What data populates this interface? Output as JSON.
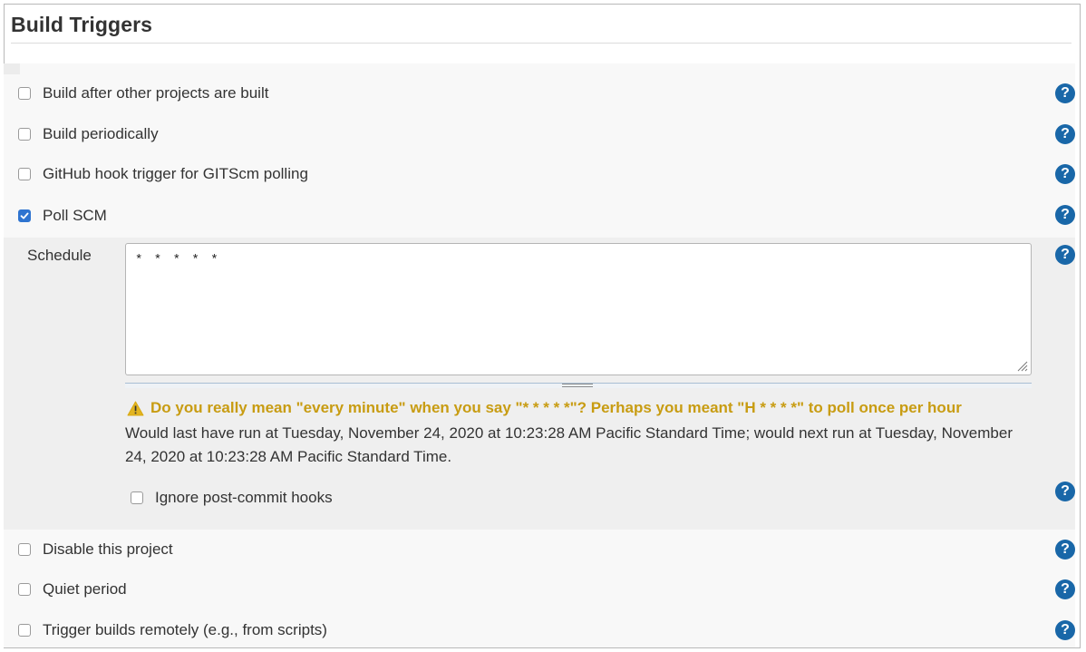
{
  "section": {
    "title": "Build Triggers"
  },
  "triggers": [
    {
      "label": "Build after other projects are built",
      "checked": false
    },
    {
      "label": "Build periodically",
      "checked": false
    },
    {
      "label": "GitHub hook trigger for GITScm polling",
      "checked": false
    },
    {
      "label": "Poll SCM",
      "checked": true
    }
  ],
  "poll_scm": {
    "schedule_label": "Schedule",
    "schedule_value": "* * * * *",
    "warning": "Do you really mean \"every minute\" when you say \"* * * * *\"? Perhaps you meant \"H * * * *\" to poll once per hour",
    "info": "Would last have run at Tuesday, November 24, 2020 at 10:23:28 AM Pacific Standard Time; would next run at Tuesday, November 24, 2020 at 10:23:28 AM Pacific Standard Time.",
    "ignore_hooks": {
      "label": "Ignore post-commit hooks",
      "checked": false
    }
  },
  "more_options": [
    {
      "label": "Disable this project",
      "checked": false
    },
    {
      "label": "Quiet period",
      "checked": false
    },
    {
      "label": "Trigger builds remotely (e.g., from scripts)",
      "checked": false
    }
  ],
  "icons": {
    "help": "question-mark-circle-icon",
    "warning": "warning-triangle-icon",
    "checkbox_checked": "checkmark-icon"
  },
  "colors": {
    "help_icon": "#1967a8",
    "checkbox_checked": "#2f74d0",
    "warning_text": "#c89c12",
    "sub_panel": "#efefef"
  }
}
